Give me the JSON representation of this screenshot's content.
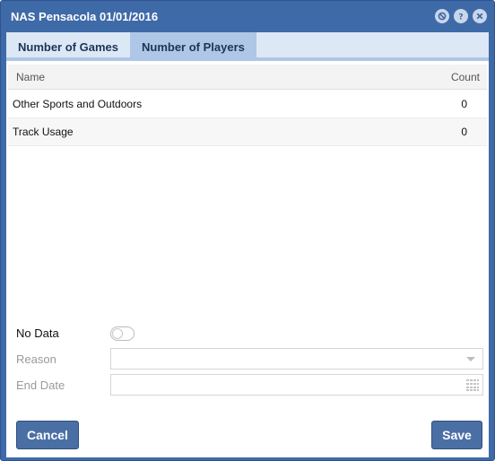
{
  "window": {
    "title": "NAS Pensacola 01/01/2016",
    "tools": [
      "block-icon",
      "help-icon",
      "close-icon"
    ]
  },
  "tabs": [
    {
      "label": "Number of Games",
      "active": false
    },
    {
      "label": "Number of Players",
      "active": true
    }
  ],
  "grid": {
    "columns": {
      "name": "Name",
      "count": "Count"
    },
    "rows": [
      {
        "name": "Other Sports and Outdoors",
        "count": "0"
      },
      {
        "name": "Track Usage",
        "count": "0"
      }
    ]
  },
  "form": {
    "no_data_label": "No Data",
    "no_data_on": false,
    "reason_label": "Reason",
    "reason_value": "",
    "end_date_label": "End Date",
    "end_date_value": ""
  },
  "buttons": {
    "cancel": "Cancel",
    "save": "Save"
  },
  "colors": {
    "window": "#3f6aa8",
    "tab_active": "#afc7e6",
    "tab_bar": "#dde8f6",
    "button": "#4a6fa5"
  }
}
